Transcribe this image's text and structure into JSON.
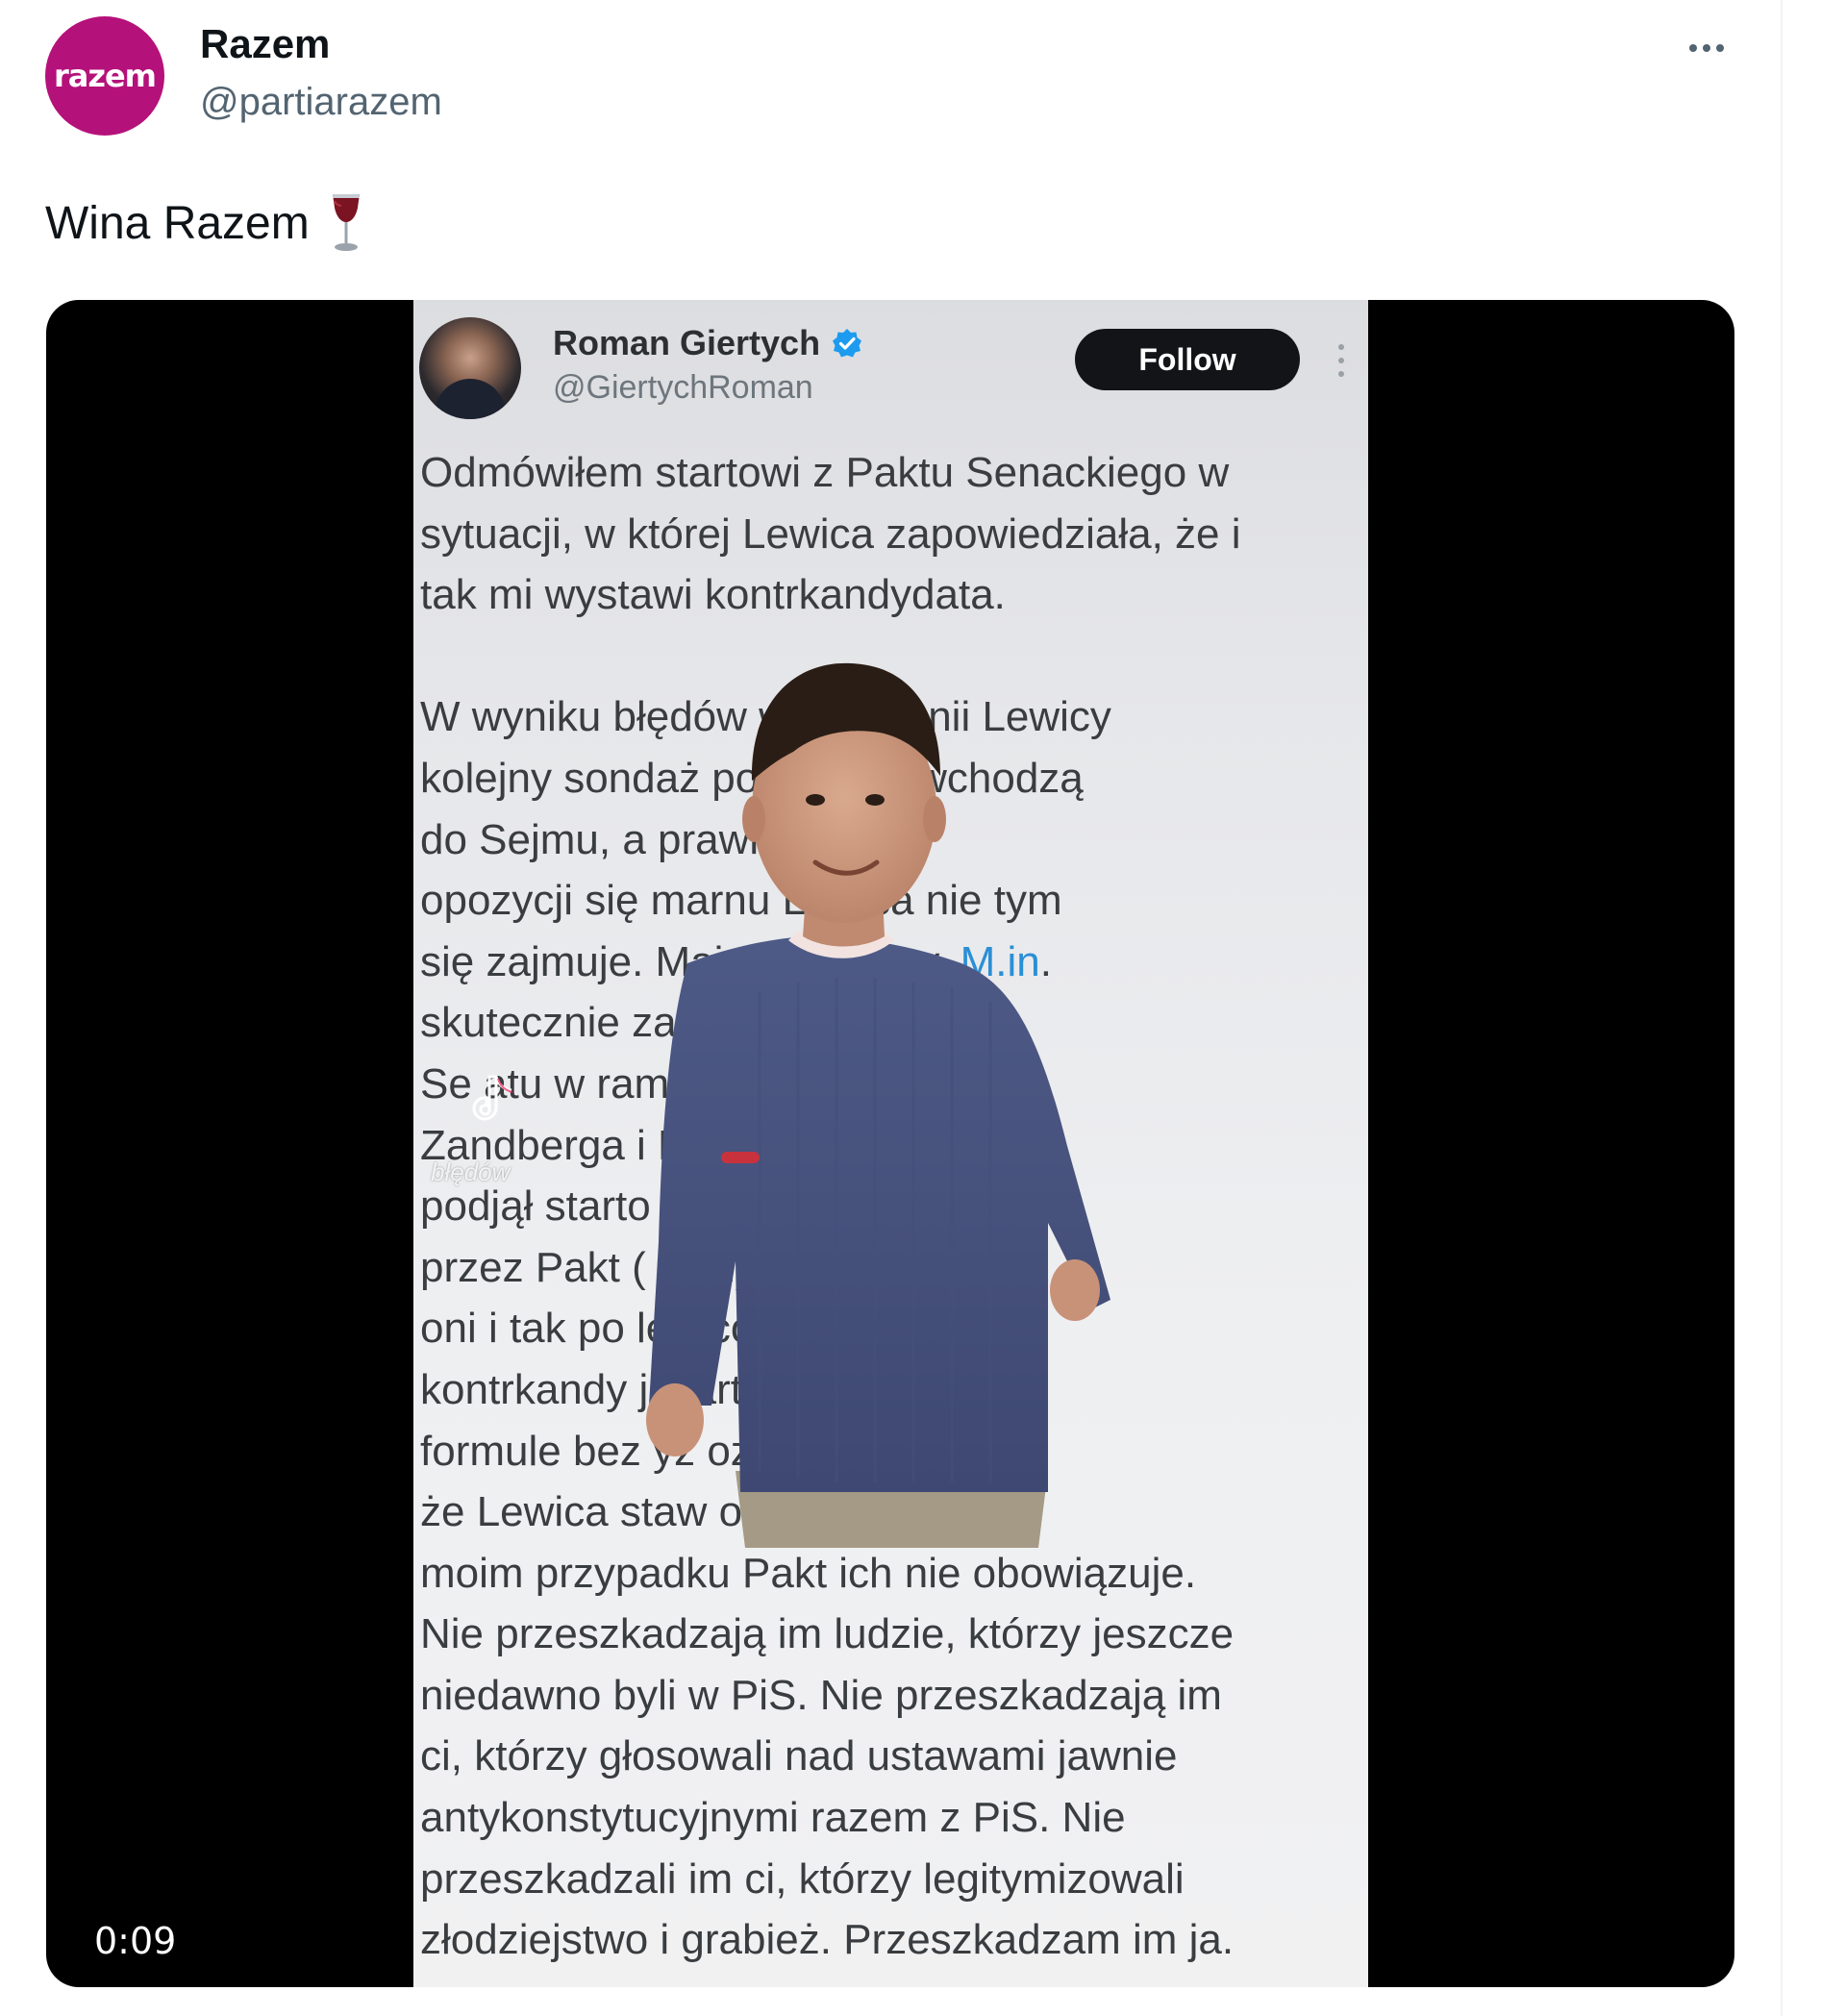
{
  "author": {
    "avatar_text": "razem",
    "name": "Razem",
    "handle": "@partiarazem"
  },
  "post": {
    "text": "Wina Razem",
    "emoji_icon": "wine-glass-icon"
  },
  "media": {
    "type": "video",
    "duration": "0:09",
    "embedded_tweet": {
      "name": "Roman Giertych",
      "handle": "@GiertychRoman",
      "verified": true,
      "follow_label": "Follow",
      "paragraph1": "Odmówiłem startowi z Paktu Senackiego w\nsytuacji, w której Lewica zapowiedziała, że i\ntak mi wystawi kontrkandydata.",
      "paragraph2_lines": [
        "W wyniku błędów w kampanii Lewicy",
        "kolejny sondaż pol   ,że nie wchodzą",
        "do Sejmu, a prawi        ektoratu",
        "opozycji się marnu        Lewica nie tym",
        "się zajmuje. Mają in        iorytety. "
      ],
      "link_text": "M.in",
      "link_suffix": ".",
      "paragraph2_rest": "skutecznie zabl                        rt do\nSe atu w ram                          edzi p.\nZandberga i B                          bym się\npodjął starto                         azanym\nprzez Pakt (                         ztyn), to\noni i tak po                         lewicowego\nkontrkandy                        j start w takiej\nformule bez                         yż oznaczały,\nże Lewica staw                       o stopnia, że w\nmoim przypadku Pakt ich nie obowiązuje.\nNie przeszkadzają im ludzie, którzy jeszcze\nniedawno byli w PiS. Nie przeszkadzają im\nci, którzy głosowali nad ustawami jawnie\nantykonstytucyjnymi razem z PiS. Nie\nprzeszkadzali im ci, którzy legitymizowali\nzłodziejstwo i grabież. Przeszkadzam im ja."
    },
    "watermark_text": "błędów",
    "overlay_icon": "tiktok-icon"
  },
  "colors": {
    "brand": "#b5117a",
    "link": "#2a8fd6",
    "verified": "#1d9bf0"
  }
}
